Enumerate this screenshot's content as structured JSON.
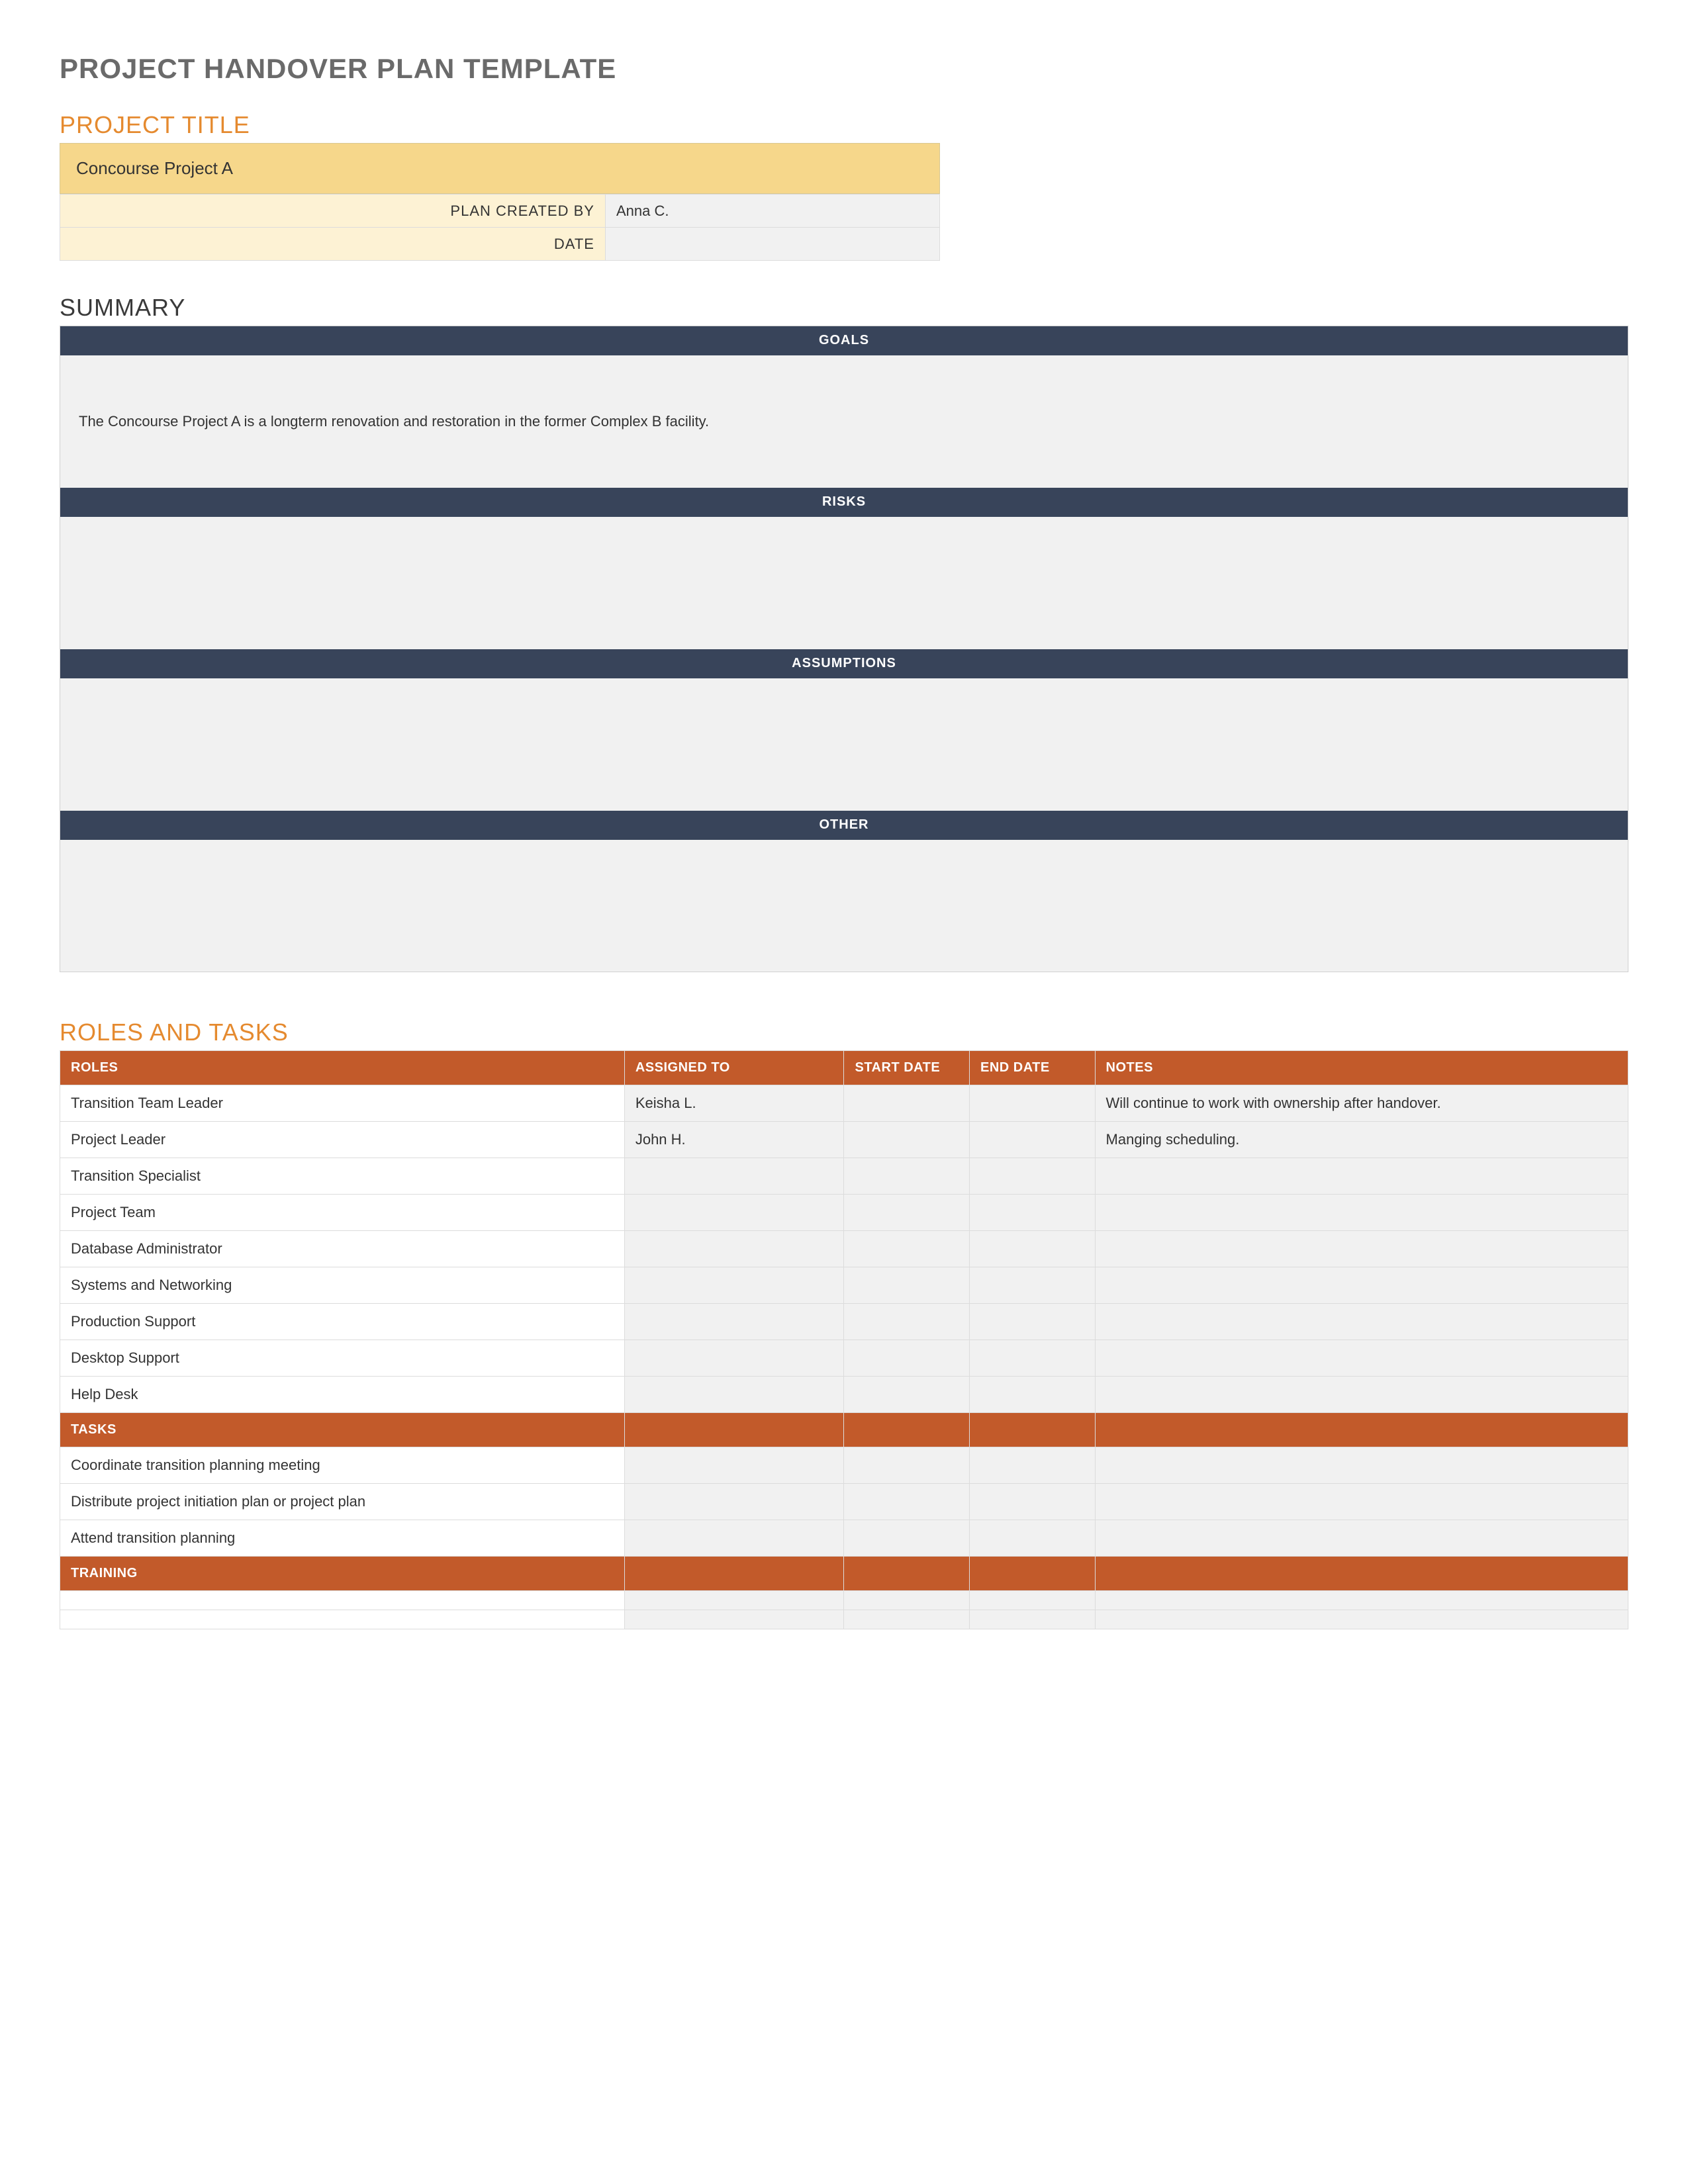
{
  "doc_title": "PROJECT HANDOVER PLAN TEMPLATE",
  "project_title_heading": "PROJECT TITLE",
  "project_title_value": "Concourse Project A",
  "meta": {
    "created_by_label": "PLAN CREATED BY",
    "created_by_value": "Anna C.",
    "date_label": "DATE",
    "date_value": ""
  },
  "summary_heading": "SUMMARY",
  "summary_sections": [
    {
      "label": "GOALS",
      "content": "The Concourse Project A is a longterm renovation and restoration in the former Complex B facility."
    },
    {
      "label": "RISKS",
      "content": ""
    },
    {
      "label": "ASSUMPTIONS",
      "content": ""
    },
    {
      "label": "OTHER",
      "content": ""
    }
  ],
  "roles_heading": "ROLES AND TASKS",
  "roles_columns": {
    "roles": "ROLES",
    "assigned": "ASSIGNED TO",
    "start": "START DATE",
    "end": "END DATE",
    "notes": "NOTES"
  },
  "roles_rows": [
    {
      "role": "Transition Team Leader",
      "assigned": "Keisha L.",
      "start": "",
      "end": "",
      "notes": "Will continue to work with ownership after handover."
    },
    {
      "role": "Project Leader",
      "assigned": "John H.",
      "start": "",
      "end": "",
      "notes": "Manging scheduling."
    },
    {
      "role": "Transition Specialist",
      "assigned": "",
      "start": "",
      "end": "",
      "notes": ""
    },
    {
      "role": "Project Team",
      "assigned": "",
      "start": "",
      "end": "",
      "notes": ""
    },
    {
      "role": "Database Administrator",
      "assigned": "",
      "start": "",
      "end": "",
      "notes": ""
    },
    {
      "role": "Systems and Networking",
      "assigned": "",
      "start": "",
      "end": "",
      "notes": ""
    },
    {
      "role": "Production Support",
      "assigned": "",
      "start": "",
      "end": "",
      "notes": ""
    },
    {
      "role": "Desktop Support",
      "assigned": "",
      "start": "",
      "end": "",
      "notes": ""
    },
    {
      "role": "Help Desk",
      "assigned": "",
      "start": "",
      "end": "",
      "notes": ""
    }
  ],
  "tasks_sub": "TASKS",
  "tasks_rows": [
    {
      "role": "Coordinate transition planning meeting",
      "assigned": "",
      "start": "",
      "end": "",
      "notes": ""
    },
    {
      "role": "Distribute project initiation plan or project plan",
      "assigned": "",
      "start": "",
      "end": "",
      "notes": ""
    },
    {
      "role": "Attend transition planning",
      "assigned": "",
      "start": "",
      "end": "",
      "notes": ""
    }
  ],
  "training_sub": "TRAINING",
  "training_rows": [
    {
      "role": "",
      "assigned": "",
      "start": "",
      "end": "",
      "notes": ""
    },
    {
      "role": "",
      "assigned": "",
      "start": "",
      "end": "",
      "notes": ""
    }
  ]
}
